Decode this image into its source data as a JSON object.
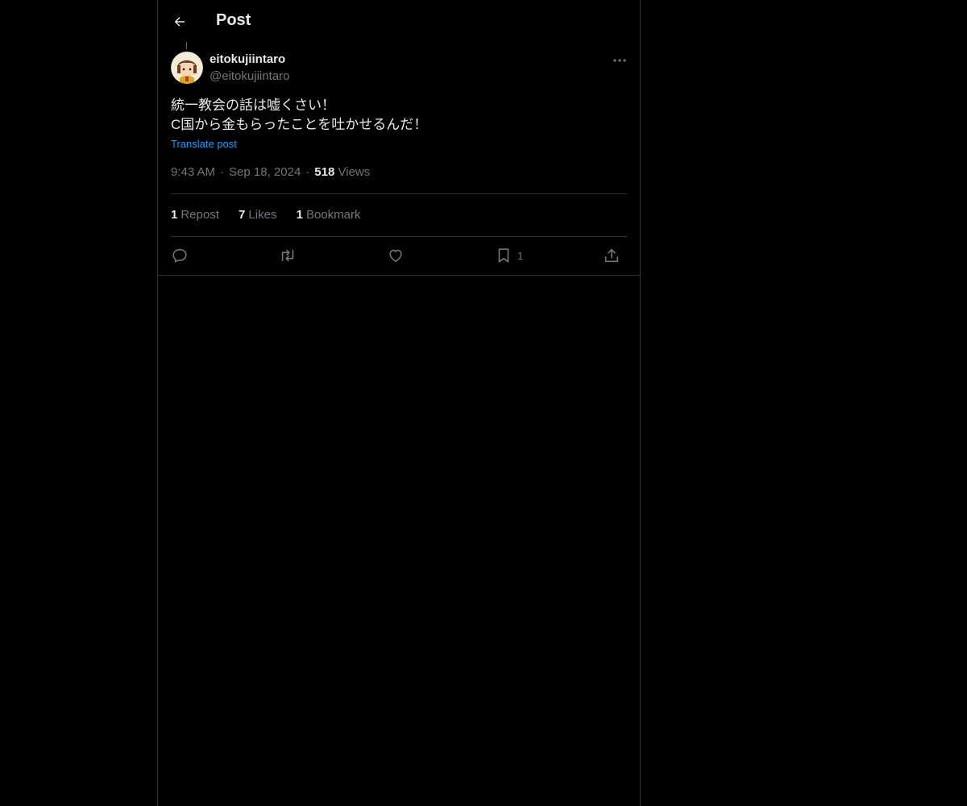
{
  "header": {
    "title": "Post",
    "back_icon": "arrow-left-icon"
  },
  "post": {
    "display_name": "eitokujiintaro",
    "handle": "@eitokujiintaro",
    "text": "統一教会の話は嘘くさい！\nC国から金もらったことを吐かせるんだ！",
    "translate_label": "Translate post",
    "time": "9:43 AM",
    "date": "Sep 18, 2024",
    "views_count": "518",
    "views_label": "Views",
    "more_icon": "more-horizontal-icon"
  },
  "stats": {
    "reposts_count": "1",
    "reposts_label": "Repost",
    "likes_count": "7",
    "likes_label": "Likes",
    "bookmarks_count": "1",
    "bookmarks_label": "Bookmark"
  },
  "actions": {
    "reply_icon": "reply-icon",
    "repost_icon": "repost-icon",
    "like_icon": "heart-icon",
    "bookmark_icon": "bookmark-icon",
    "bookmark_count": "1",
    "share_icon": "share-icon"
  },
  "colors": {
    "background": "#000000",
    "text_primary": "#e7e9ea",
    "text_secondary": "#71767b",
    "link": "#1d9bf0",
    "border": "#2f3336"
  }
}
